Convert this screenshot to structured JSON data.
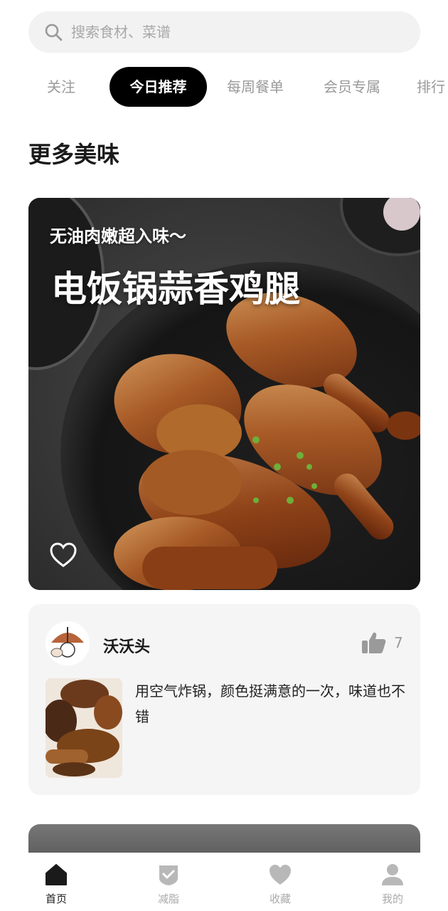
{
  "search": {
    "placeholder": "搜索食材、菜谱"
  },
  "tabs": [
    {
      "label": "关注",
      "active": false
    },
    {
      "label": "今日推荐",
      "active": true
    },
    {
      "label": "每周餐单",
      "active": false
    },
    {
      "label": "会员专属",
      "active": false
    },
    {
      "label": "排行",
      "active": false
    }
  ],
  "section": {
    "title": "更多美味"
  },
  "hero": {
    "subtitle": "无油肉嫩超入味～",
    "title": "电饭锅蒜香鸡腿",
    "favorite_icon": "heart-outline-icon"
  },
  "comment": {
    "username": "沃沃头",
    "like_icon": "thumbs-up-icon",
    "like_count": "7",
    "text": "用空气炸锅，颜色挺满意的一次，味道也不错"
  },
  "bottom_nav": [
    {
      "label": "首页",
      "icon": "home-icon",
      "active": true
    },
    {
      "label": "减脂",
      "icon": "shield-check-icon",
      "active": false
    },
    {
      "label": "收藏",
      "icon": "heart-icon",
      "active": false
    },
    {
      "label": "我的",
      "icon": "user-icon",
      "active": false
    }
  ],
  "colors": {
    "active_tab_bg": "#000000",
    "inactive_text": "#9a9a9a",
    "card_bg": "#f5f5f5"
  }
}
